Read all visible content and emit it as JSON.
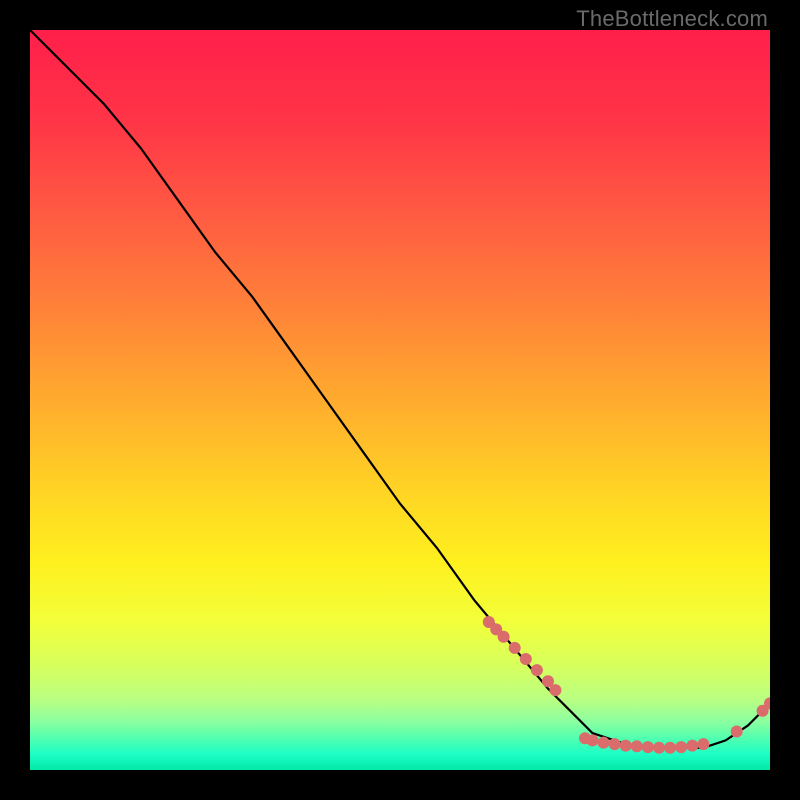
{
  "watermark": "TheBottleneck.com",
  "colors": {
    "curve_stroke": "#000000",
    "dot_fill": "#da6c6c",
    "gradient_stops": [
      {
        "offset": 0.0,
        "color": "#ff1f4a"
      },
      {
        "offset": 0.12,
        "color": "#ff3447"
      },
      {
        "offset": 0.25,
        "color": "#ff5b42"
      },
      {
        "offset": 0.38,
        "color": "#ff8338"
      },
      {
        "offset": 0.5,
        "color": "#ffab2e"
      },
      {
        "offset": 0.62,
        "color": "#ffd324"
      },
      {
        "offset": 0.72,
        "color": "#fff01f"
      },
      {
        "offset": 0.8,
        "color": "#f2ff3a"
      },
      {
        "offset": 0.86,
        "color": "#d6ff5e"
      },
      {
        "offset": 0.905,
        "color": "#b9ff82"
      },
      {
        "offset": 0.935,
        "color": "#8affa0"
      },
      {
        "offset": 0.958,
        "color": "#4fffb0"
      },
      {
        "offset": 0.978,
        "color": "#1fffc6"
      },
      {
        "offset": 1.0,
        "color": "#00e8a8"
      }
    ]
  },
  "chart_data": {
    "type": "line",
    "title": "",
    "xlabel": "",
    "ylabel": "",
    "xlim": [
      0,
      100
    ],
    "ylim": [
      0,
      100
    ],
    "grid": false,
    "legend": false,
    "series": [
      {
        "name": "bottleneck_curve",
        "x": [
          0,
          3,
          6,
          10,
          15,
          20,
          25,
          30,
          35,
          40,
          45,
          50,
          55,
          60,
          65,
          70,
          73,
          76,
          79,
          82,
          85,
          88,
          91,
          94,
          97,
          100
        ],
        "y": [
          100,
          97,
          94,
          90,
          84,
          77,
          70,
          64,
          57,
          50,
          43,
          36,
          30,
          23,
          17,
          11,
          8,
          5,
          4,
          3,
          3,
          3,
          3,
          4,
          6,
          9
        ]
      }
    ],
    "marker_points": [
      {
        "x": 62,
        "y": 20
      },
      {
        "x": 63,
        "y": 19
      },
      {
        "x": 64,
        "y": 18
      },
      {
        "x": 65.5,
        "y": 16.5
      },
      {
        "x": 67,
        "y": 15
      },
      {
        "x": 68.5,
        "y": 13.5
      },
      {
        "x": 70,
        "y": 12
      },
      {
        "x": 71,
        "y": 10.8
      },
      {
        "x": 75,
        "y": 4.3
      },
      {
        "x": 76,
        "y": 4.0
      },
      {
        "x": 77.5,
        "y": 3.7
      },
      {
        "x": 79,
        "y": 3.5
      },
      {
        "x": 80.5,
        "y": 3.3
      },
      {
        "x": 82,
        "y": 3.2
      },
      {
        "x": 83.5,
        "y": 3.1
      },
      {
        "x": 85,
        "y": 3.0
      },
      {
        "x": 86.5,
        "y": 3.0
      },
      {
        "x": 88,
        "y": 3.1
      },
      {
        "x": 89.5,
        "y": 3.3
      },
      {
        "x": 91,
        "y": 3.5
      },
      {
        "x": 95.5,
        "y": 5.2
      },
      {
        "x": 99,
        "y": 8.0
      },
      {
        "x": 100,
        "y": 9.0
      }
    ]
  }
}
